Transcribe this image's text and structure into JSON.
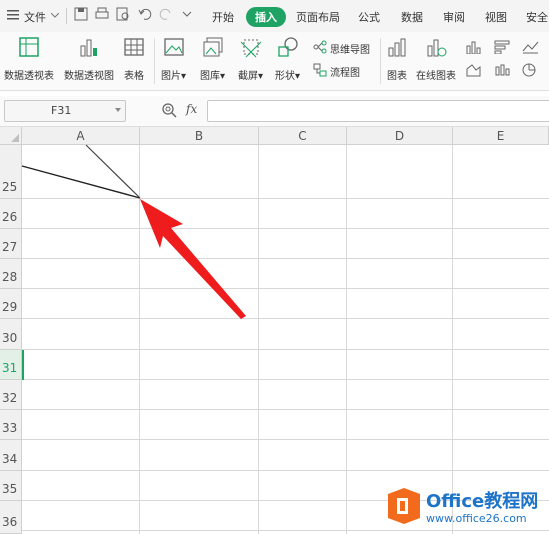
{
  "menubar": {
    "file_label": "文件",
    "tabs": [
      "开始",
      "插入",
      "页面布局",
      "公式",
      "数据",
      "审阅",
      "视图",
      "安全"
    ],
    "active_tab": "插入"
  },
  "ribbon": {
    "pivot_table": "数据透视表",
    "pivot_chart": "数据透视图",
    "table": "表格",
    "picture": "图片",
    "gallery": "图库",
    "screenshot": "截屏",
    "shape": "形状",
    "mindmap": "思维导图",
    "flowchart": "流程图",
    "chart": "图表",
    "online_chart": "在线图表"
  },
  "formula_bar": {
    "cell_ref": "F31",
    "fx": "fx",
    "value": ""
  },
  "columns": [
    "A",
    "B",
    "C",
    "D",
    "E"
  ],
  "rows": [
    "25",
    "26",
    "27",
    "28",
    "29",
    "30",
    "31",
    "32",
    "33",
    "34",
    "35",
    "36"
  ],
  "selected_row": "31",
  "colors": {
    "accent": "#1fa365",
    "arrow": "#ee1c1c",
    "watermark": "#1e74c8",
    "watermark_logo": "#f26a1b"
  },
  "watermark": {
    "title": "Office教程网",
    "subtitle": "www.office26.com"
  }
}
